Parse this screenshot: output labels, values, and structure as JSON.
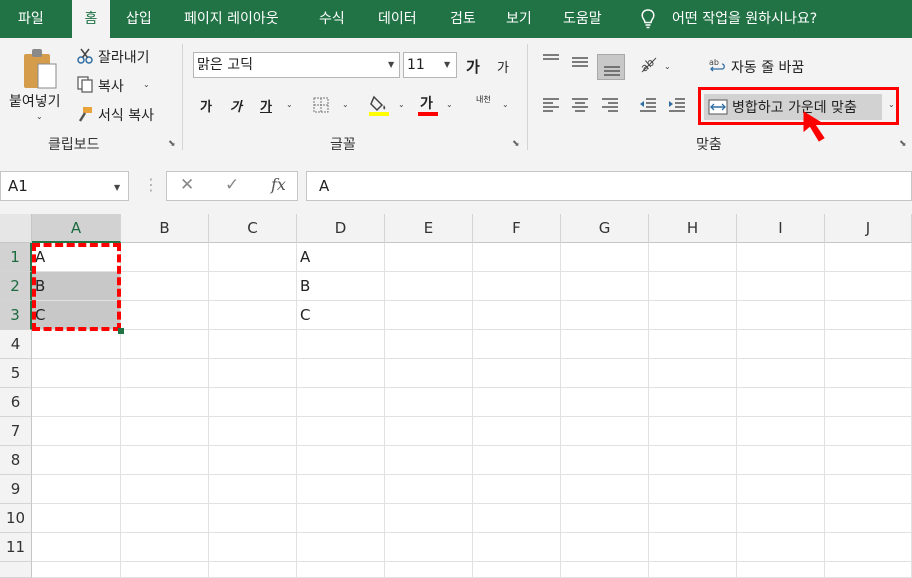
{
  "tabs": [
    "파일",
    "홈",
    "삽입",
    "페이지 레이아웃",
    "수식",
    "데이터",
    "검토",
    "보기",
    "도움말"
  ],
  "tell_me": "어떤 작업을 원하시나요?",
  "clipboard": {
    "paste": "붙여넣기",
    "cut": "잘라내기",
    "copy": "복사",
    "format_painter": "서식 복사",
    "label": "클립보드"
  },
  "font": {
    "name": "맑은 고딕",
    "size": "11",
    "grow": "가",
    "shrink": "가",
    "bold": "가",
    "italic": "가",
    "underline": "가",
    "font_color": "가",
    "phonetic": "내천",
    "label": "글꼴",
    "fill_color": "#ffff00",
    "text_color": "#ff0000"
  },
  "alignment": {
    "wrap_text": "자동 줄 바꿈",
    "merge_center": "병합하고 가운데 맞춤",
    "label": "맞춤"
  },
  "formula_bar": {
    "name_box": "A1",
    "cancel": "✕",
    "enter": "✓",
    "fx": "fx",
    "value": "A"
  },
  "sheet": {
    "columns": [
      "A",
      "B",
      "C",
      "D",
      "E",
      "F",
      "G",
      "H",
      "I",
      "J"
    ],
    "rows": [
      "1",
      "2",
      "3",
      "4",
      "5",
      "6",
      "7",
      "8",
      "9",
      "10",
      "11"
    ],
    "cells": {
      "A1": "A",
      "A2": "B",
      "A3": "C",
      "D1": "A",
      "D2": "B",
      "D3": "C"
    }
  },
  "colors": {
    "accent": "#217346",
    "highlight": "#ff0000"
  }
}
